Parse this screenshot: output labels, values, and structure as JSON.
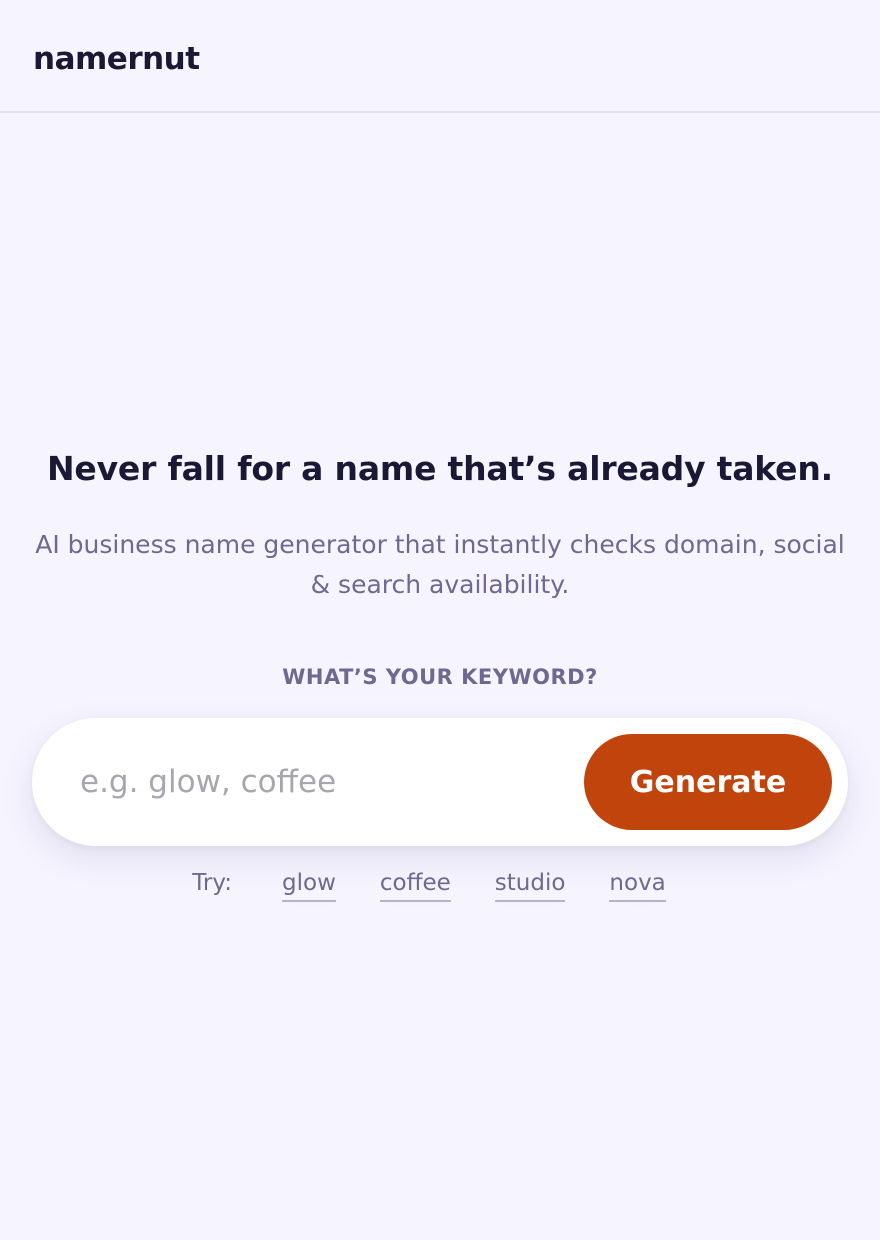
{
  "header": {
    "brand": "namernut"
  },
  "hero": {
    "headline": "Never fall for a name that’s already taken.",
    "subhead": "AI business name generator that instantly checks domain, social & search availability.",
    "keyword_label": "WHAT’S YOUR KEYWORD?"
  },
  "search": {
    "value": "",
    "placeholder": "e.g. glow, coffee",
    "button_label": "Generate"
  },
  "suggestions": {
    "label": "Try:",
    "items": [
      "glow",
      "coffee",
      "studio",
      "nova"
    ]
  },
  "colors": {
    "background": "#f6f4ff",
    "accent": "#c2440d",
    "text": "#1b1835",
    "muted": "#6e6990"
  }
}
